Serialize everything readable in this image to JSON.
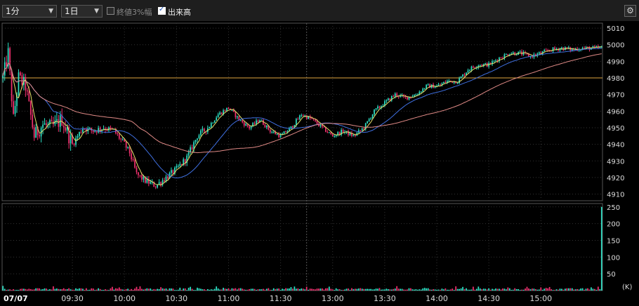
{
  "toolbar": {
    "interval": "1分",
    "span": "1日",
    "opt_change3": "終値3%幅",
    "opt_change3_checked": false,
    "opt_volume": "出来高",
    "opt_volume_checked": true
  },
  "chart_data": {
    "type": "candlestick",
    "date_label": "07/07",
    "x_ticks": [
      "09:30",
      "10:00",
      "10:30",
      "11:00",
      "11:30",
      "13:00",
      "13:30",
      "14:00",
      "14:30",
      "15:00"
    ],
    "x_tick_index": [
      40,
      70,
      100,
      130,
      160,
      190,
      220,
      250,
      280,
      310
    ],
    "n_bars": 346,
    "price": {
      "ylim": [
        4906,
        5013
      ],
      "ticks": [
        4910,
        4920,
        4930,
        4940,
        4950,
        4960,
        4970,
        4980,
        4990,
        5000,
        5010
      ],
      "reference_line": 4980,
      "reference_color": "#e0a640",
      "keypoints": [
        [
          0,
          4980
        ],
        [
          3,
          4995
        ],
        [
          6,
          4955
        ],
        [
          9,
          4980
        ],
        [
          13,
          4975
        ],
        [
          18,
          4945
        ],
        [
          23,
          4952
        ],
        [
          28,
          4950
        ],
        [
          34,
          4955
        ],
        [
          40,
          4940
        ],
        [
          46,
          4950
        ],
        [
          52,
          4948
        ],
        [
          58,
          4950
        ],
        [
          64,
          4948
        ],
        [
          70,
          4940
        ],
        [
          73,
          4935
        ],
        [
          77,
          4922
        ],
        [
          82,
          4918
        ],
        [
          88,
          4915
        ],
        [
          94,
          4920
        ],
        [
          100,
          4925
        ],
        [
          106,
          4932
        ],
        [
          112,
          4945
        ],
        [
          118,
          4950
        ],
        [
          124,
          4958
        ],
        [
          130,
          4962
        ],
        [
          136,
          4955
        ],
        [
          142,
          4950
        ],
        [
          148,
          4955
        ],
        [
          154,
          4948
        ],
        [
          160,
          4945
        ],
        [
          166,
          4950
        ],
        [
          172,
          4958
        ],
        [
          178,
          4955
        ],
        [
          184,
          4950
        ],
        [
          190,
          4945
        ],
        [
          196,
          4948
        ],
        [
          202,
          4945
        ],
        [
          208,
          4950
        ],
        [
          214,
          4960
        ],
        [
          220,
          4965
        ],
        [
          226,
          4970
        ],
        [
          232,
          4968
        ],
        [
          238,
          4970
        ],
        [
          244,
          4975
        ],
        [
          250,
          4975
        ],
        [
          256,
          4978
        ],
        [
          262,
          4978
        ],
        [
          268,
          4985
        ],
        [
          274,
          4988
        ],
        [
          280,
          4988
        ],
        [
          286,
          4992
        ],
        [
          292,
          4995
        ],
        [
          298,
          4995
        ],
        [
          304,
          4993
        ],
        [
          310,
          4995
        ],
        [
          316,
          4997
        ],
        [
          322,
          4998
        ],
        [
          328,
          4997
        ],
        [
          334,
          4998
        ],
        [
          340,
          4998
        ]
      ],
      "ma_short_color": "#3f6fe0",
      "ma_long_color": "#e08a86"
    },
    "volume": {
      "unit": "(K)",
      "ylim": [
        0,
        260
      ],
      "ticks": [
        50,
        100,
        150,
        200,
        250
      ],
      "last_bar": 250,
      "typical": 4
    },
    "up_color": "#2de0c4",
    "down_color": "#f0306e"
  }
}
